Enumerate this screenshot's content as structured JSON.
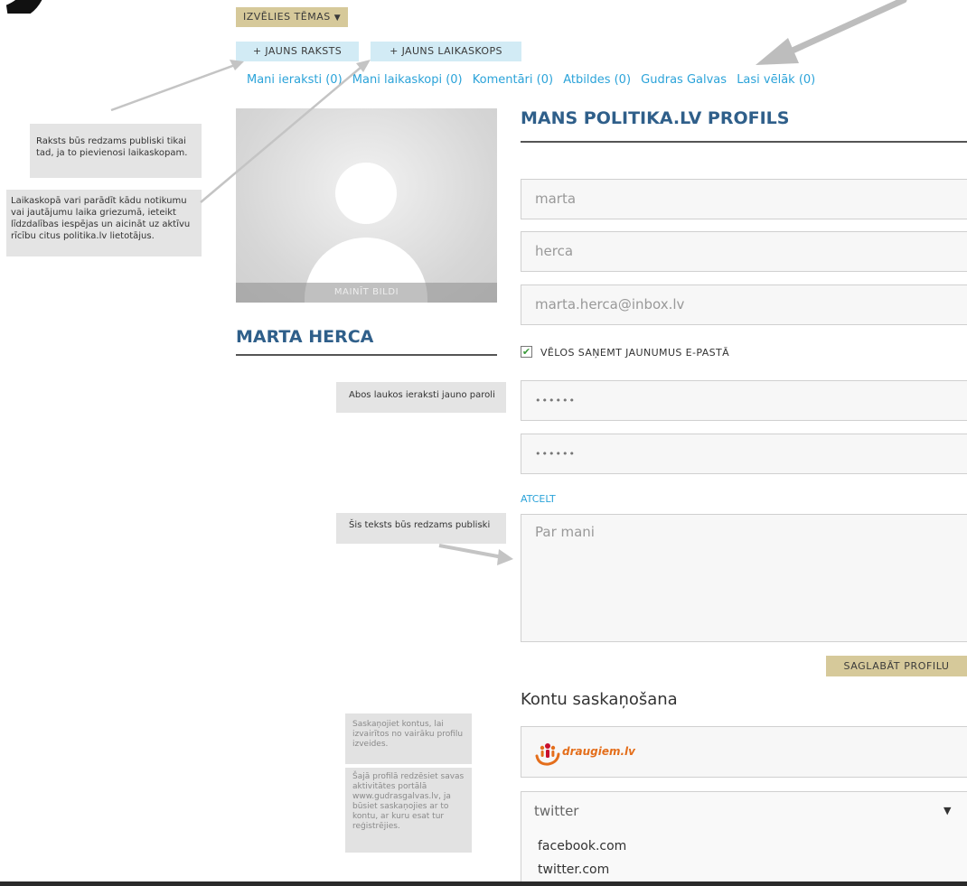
{
  "header": {
    "theme_button": "IZVĒLIES TĒMAS",
    "new_article_button": "+ JAUNS RAKSTS",
    "new_timeline_button": "+ JAUNS LAIKASKOPS"
  },
  "nav": {
    "items": [
      {
        "label": "Mani ieraksti (0)"
      },
      {
        "label": "Mani laikaskopi (0)"
      },
      {
        "label": "Komentāri (0)"
      },
      {
        "label": "Atbildes (0)"
      },
      {
        "label": "Gudras Galvas"
      },
      {
        "label": "Lasi vēlāk (0)"
      }
    ]
  },
  "annotations": {
    "article_note": "Raksts būs redzams publiski tikai tad, ja to pievienosi laikaskopam.",
    "timeline_note": "Laikaskopā vari parādīt kādu notikumu vai jautājumu laika griezumā, ieteikt līdzdalības iespējas un aicināt uz aktīvu rīcību citus politika.lv lietotājus.",
    "password_note": "Abos laukos ieraksti jauno paroli",
    "about_note": "Šis teksts būs redzams publiski",
    "sync_note": "Saskaņojiet kontus, lai izvairītos no vairāku profilu izveides.",
    "activity_note": "Šajā profilā redzēsiet savas aktivitātes portālā www.gudrasgalvas.lv, ja būsiet saskaņojies ar to kontu, ar kuru esat tur reģistrējies."
  },
  "profile": {
    "change_photo": "MAINĪT BILDI",
    "user_name": "MARTA HERCA",
    "title": "MANS POLITIKA.LV PROFILS",
    "first_name": "marta",
    "last_name": "herca",
    "email": "marta.herca@inbox.lv",
    "newsletter_label": "VĒLOS SAŅEMT JAUNUMUS E-PASTĀ",
    "newsletter_checked": true,
    "password": "••••••",
    "password_repeat": "••••••",
    "cancel_link": "ATCELT",
    "about_placeholder": "Par mani",
    "save_button": "SAGLABĀT PROFILU"
  },
  "sync": {
    "title": "Kontu saskaņošana",
    "draugiem_label": "draugiem.lv",
    "select_value": "twitter",
    "options": [
      "facebook.com",
      "twitter.com"
    ]
  },
  "colors": {
    "accent_tan": "#d6c99a",
    "accent_blue_light": "#d2ebf5",
    "link_blue": "#2ba3d9",
    "heading_blue": "#2f5f8a",
    "draugiem_orange": "#e46e1b"
  }
}
